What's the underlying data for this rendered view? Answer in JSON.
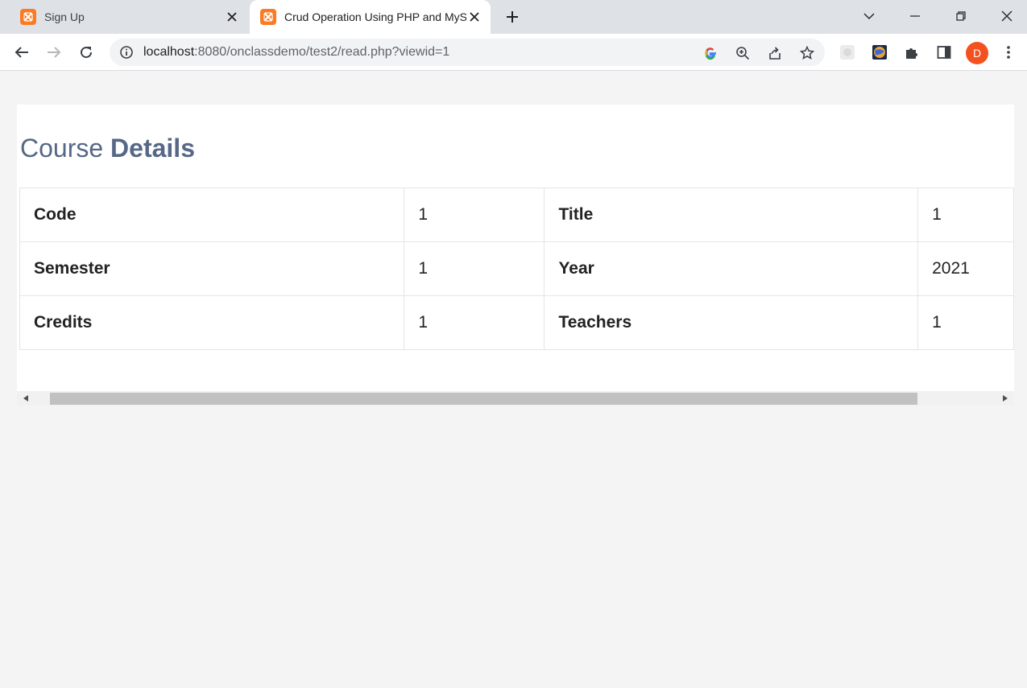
{
  "tabs": [
    {
      "title": "Sign Up"
    },
    {
      "title": "Crud Operation Using PHP and MySQL"
    }
  ],
  "address_bar": {
    "host": "localhost",
    "path": ":8080/onclassdemo/test2/read.php?viewid=1"
  },
  "profile": {
    "initial": "D"
  },
  "page": {
    "heading_light": "Course",
    "heading_bold": "Details",
    "rows": [
      {
        "label1": "Code",
        "value1": "1",
        "label2": "Title",
        "value2": "1"
      },
      {
        "label1": "Semester",
        "value1": "1",
        "label2": "Year",
        "value2": "2021"
      },
      {
        "label1": "Credits",
        "value1": "1",
        "label2": "Teachers",
        "value2": "1"
      }
    ]
  },
  "colors": {
    "heading": "#566787",
    "favicon": "#fb7a24",
    "avatar": "#f4511e"
  }
}
